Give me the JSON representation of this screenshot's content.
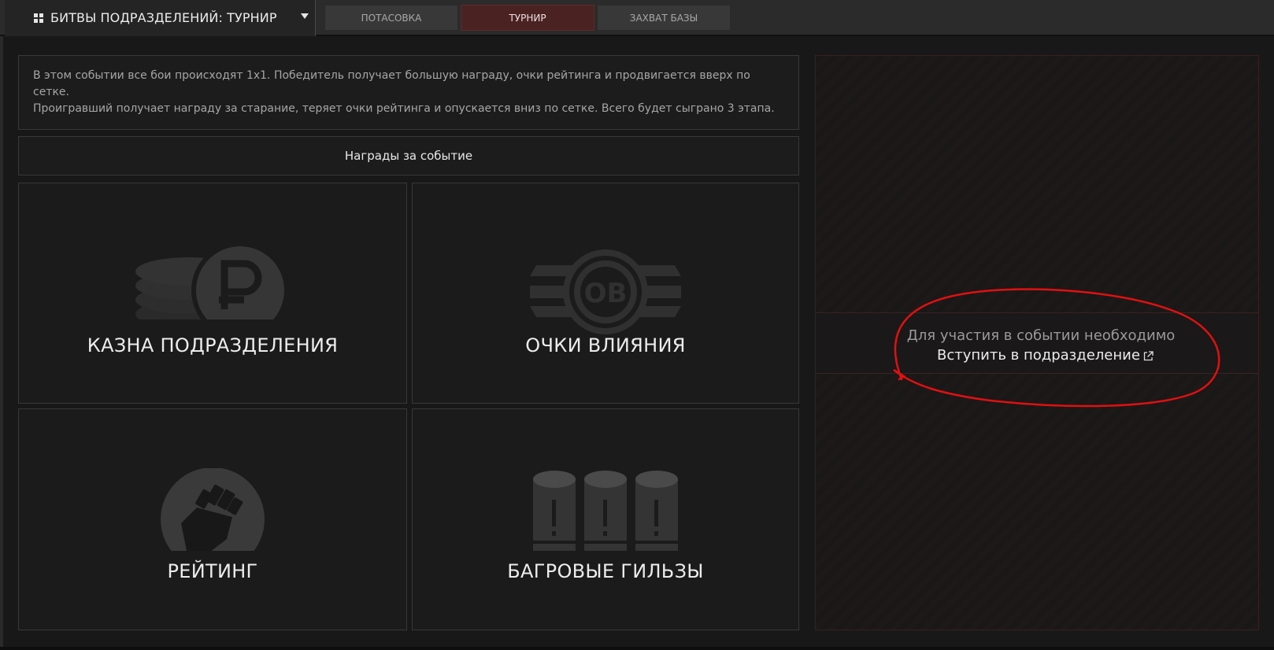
{
  "header": {
    "mode_label": "БИТВЫ ПОДРАЗДЕЛЕНИЙ: ТУРНИР",
    "tabs": [
      {
        "label": "ПОТАСОВКА",
        "active": false
      },
      {
        "label": "ТУРНИР",
        "active": true
      },
      {
        "label": "ЗАХВАТ БАЗЫ",
        "active": false
      }
    ]
  },
  "description": {
    "line1": "В этом событии все бои происходят 1x1. Победитель получает большую награду, очки рейтинга и продвигается вверх по сетке.",
    "line2": "Проигравший получает награду за старание, теряет очки рейтинга и опускается вниз по сетке. Всего будет сыграно 3 этапа."
  },
  "rewards": {
    "header": "Награды за событие",
    "cards": [
      {
        "title": "КАЗНА ПОДРАЗДЕЛЕНИЯ",
        "icon": "coins-ruble-icon"
      },
      {
        "title": "ОЧКИ ВЛИЯНИЯ",
        "icon": "influence-points-icon"
      },
      {
        "title": "РЕЙТИНГ",
        "icon": "fist-icon"
      },
      {
        "title": "БАГРОВЫЕ ГИЛЬЗЫ",
        "icon": "crimson-casings-icon"
      }
    ]
  },
  "side_panel": {
    "requirement_text": "Для участия в событии необходимо",
    "join_link": "Вступить в подразделение"
  },
  "colors": {
    "active_tab": "#4a2222",
    "annotation": "#e01010"
  }
}
